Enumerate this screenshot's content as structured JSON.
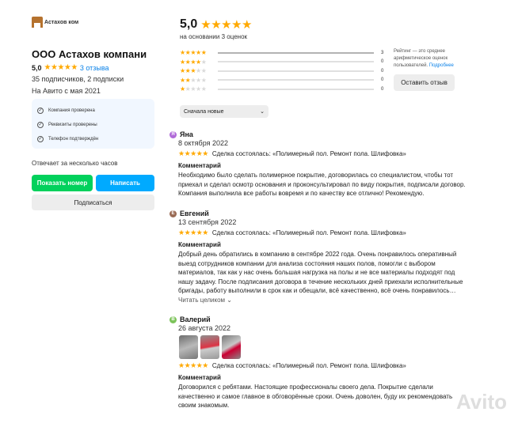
{
  "company": {
    "logo_text": "Астахов ком",
    "name": "ООО Астахов компани",
    "rating": "5,0",
    "reviews_link": "3 отзыва",
    "subscribers": "35 подписчиков, 2 подписки",
    "since": "На Авито с мая 2021",
    "verifications": [
      "Компания проверена",
      "Реквизиты проверены",
      "Телефон подтверждён"
    ],
    "reply_time": "Отвечает за несколько часов",
    "show_phone_label": "Показать номер",
    "write_label": "Написать",
    "subscribe_label": "Подписаться"
  },
  "summary": {
    "rating": "5,0",
    "based_on": "на основании 3 оценок",
    "distribution": [
      {
        "stars": 5,
        "count": "3",
        "fraction": 1.0
      },
      {
        "stars": 4,
        "count": "0",
        "fraction": 0
      },
      {
        "stars": 3,
        "count": "0",
        "fraction": 0
      },
      {
        "stars": 2,
        "count": "0",
        "fraction": 0
      },
      {
        "stars": 1,
        "count": "0",
        "fraction": 0
      }
    ],
    "note_prefix": "Рейтинг — это среднее арифметическое оценок пользователей.",
    "note_link": "Подробнее",
    "leave_review_label": "Оставить отзыв",
    "sort_label": "Сначала новые"
  },
  "reviews": [
    {
      "initial": "Я",
      "avatar_color": "#b06ad8",
      "name": "Яна",
      "date": "8 октября 2022",
      "deal": "Сделка состоялась: «Полимерный пол. Ремонт пола. Шлифовка»",
      "comment_label": "Комментарий",
      "comment": "Необходимо было сделать полимерное покрытие, договорилась со специалистом, чтобы тот приехал и сделал осмотр основания и проконсультировал по виду покрытия, подписали договор. Компания выполнила все работы вовремя и по качеству все отлично! Рекомендую."
    },
    {
      "initial": "Е",
      "avatar_color": "#9a6b55",
      "name": "Евгений",
      "date": "13 сентября 2022",
      "deal": "Сделка состоялась: «Полимерный пол. Ремонт пола. Шлифовка»",
      "comment_label": "Комментарий",
      "comment": "Добрый день обратились в компанию в сентябре 2022 года. Очень понравилось оперативный выезд сотрудников компании для анализа состояния наших полов, помогли с выбором материалов, так как у нас очень большая нагрузка на полы и не все материалы подходят под нашу задачу. После подписания договора в течение нескольких дней приехали исполнительные бригады, работу выполнили в срок как и обещали, всё качественно, всё очень понравилось…",
      "read_more": "Читать целиком"
    },
    {
      "initial": "В",
      "avatar_color": "#7cc35a",
      "name": "Валерий",
      "date": "26 августа 2022",
      "deal": "Сделка состоялась: «Полимерный пол. Ремонт пола. Шлифовка»",
      "comment_label": "Комментарий",
      "comment": "Договорился с ребятами. Настоящие профессионалы своего дела. Покрытие сделали качественно и самое главное в обговорённые сроки. Очень доволен, буду их рекомендовать своим знакомым."
    }
  ],
  "watermark": "Avito",
  "colors": {
    "star": "#ffa900",
    "green_button": "#02d15c",
    "blue_button": "#00aaff",
    "link": "#0a82e8"
  }
}
